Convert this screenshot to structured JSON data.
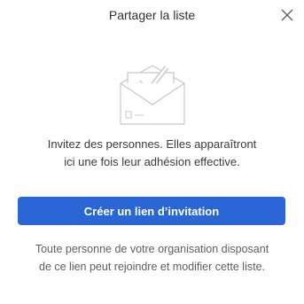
{
  "dialog": {
    "title": "Partager la liste",
    "close_icon": "close-icon",
    "illustration_icon": "envelope-checkmark-illustration",
    "description_line1": "Invitez des personnes. Elles apparaîtront",
    "description_line2": "ici une fois leur adhésion effective.",
    "primary_button_label": "Créer un lien d’invitation",
    "note_line1": "Toute personne de votre organisation disposant",
    "note_line2": "de ce lien peut rejoindre et modifier cette liste."
  },
  "colors": {
    "accent": "#2a66d6",
    "text_primary": "#323130",
    "text_secondary": "#605e5c"
  }
}
